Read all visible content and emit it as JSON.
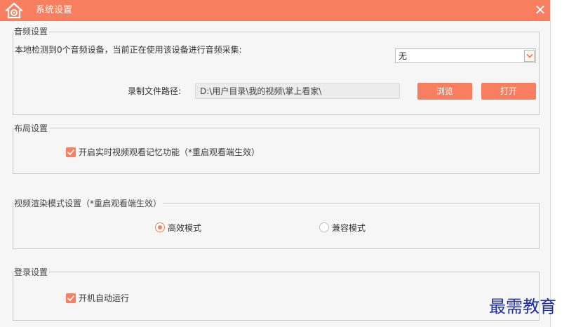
{
  "window": {
    "title": "系统设置",
    "close_glyph": "✕"
  },
  "audio": {
    "legend": "音频设置",
    "detect_text": "本地检测到0个音频设备，当前正在使用该设备进行音频采集:",
    "device_selected": "无",
    "path_label": "录制文件路径:",
    "path_value": "D:\\用户目录\\我的视频\\掌上看家\\",
    "browse_label": "浏览",
    "open_label": "打开"
  },
  "layout_section": {
    "legend": "布局设置",
    "memory_checkbox": {
      "label": "开启实时视频观看记忆功能（*重启观看端生效）",
      "checked": true
    }
  },
  "render_section": {
    "legend": "视频渲染模式设置（*重启观看端生效）",
    "options": [
      {
        "label": "高效模式",
        "selected": true
      },
      {
        "label": "兼容模式",
        "selected": false
      }
    ]
  },
  "login_section": {
    "legend": "登录设置",
    "autostart_checkbox": {
      "label": "开机自动运行",
      "checked": true
    }
  },
  "watermark": "最需教育",
  "colors": {
    "accent": "#f77f5f",
    "window_bg": "#f6f6f6",
    "watermark": "#1f2f9c"
  },
  "icons": {
    "app": "house-icon",
    "close": "close-icon",
    "dropdown": "chevron-down-icon",
    "check": "check-icon"
  }
}
